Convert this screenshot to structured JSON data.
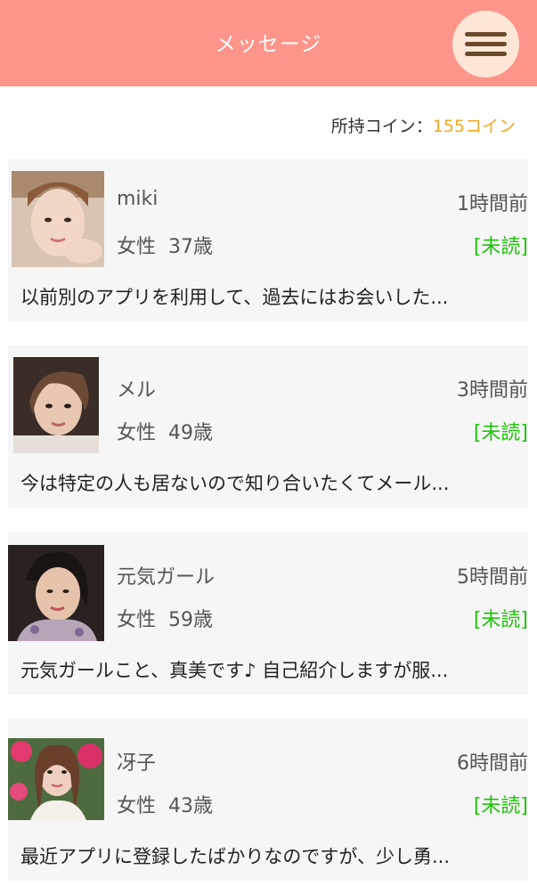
{
  "header": {
    "title": "メッセージ",
    "menu_icon": "hamburger-menu-icon",
    "background_color": "#fe958a",
    "menu_button_color": "#fde6d6"
  },
  "coins": {
    "label": "所持コイン：",
    "value": "155コイン",
    "value_color": "#f5a623"
  },
  "messages": [
    {
      "name": "miki",
      "time": "1時間前",
      "info": "女性  37歳",
      "status": "[未読]",
      "preview": "以前別のアプリを利用して、過去にはお会いした...",
      "avatar_icon": "profile-photo"
    },
    {
      "name": "メル",
      "time": "3時間前",
      "info": "女性  49歳",
      "status": "[未読]",
      "preview": "今は特定の人も居ないので知り合いたくてメール...",
      "avatar_icon": "profile-photo"
    },
    {
      "name": "元気ガール",
      "time": "5時間前",
      "info": "女性  59歳",
      "status": "[未読]",
      "preview": "元気ガールこと、真美です♪ 自己紹介しますが服...",
      "avatar_icon": "profile-photo"
    },
    {
      "name": "冴子",
      "time": "6時間前",
      "info": "女性  43歳",
      "status": "[未読]",
      "preview": "最近アプリに登録したばかりなのですが、少し勇...",
      "avatar_icon": "profile-photo"
    }
  ],
  "colors": {
    "unread": "#22c20e",
    "card_background": "#f6f6f6"
  }
}
